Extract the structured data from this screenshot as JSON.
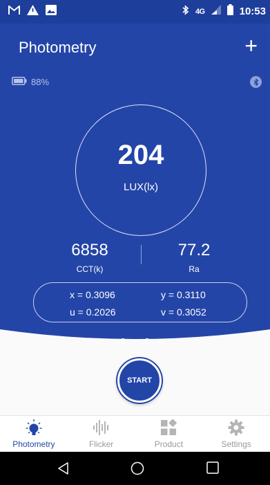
{
  "status_bar": {
    "network": "4G",
    "time": "10:53"
  },
  "app_bar": {
    "title": "Photometry",
    "add_label": "+"
  },
  "device": {
    "battery": "88%"
  },
  "reading": {
    "lux_value": "204",
    "lux_unit": "LUX(lx)",
    "cct_value": "6858",
    "cct_label": "CCT(k)",
    "ra_value": "77.2",
    "ra_label": "Ra",
    "x": "x = 0.3096",
    "y": "y = 0.3110",
    "u": "u = 0.2026",
    "v": "v = 0.3052"
  },
  "pager": {
    "page_count": 2,
    "active_page": 1
  },
  "start_label": "START",
  "tabs": [
    {
      "label": "Photometry",
      "icon": "bulb-icon",
      "active": true
    },
    {
      "label": "Flicker",
      "icon": "waveform-icon",
      "active": false
    },
    {
      "label": "Product",
      "icon": "grid-icon",
      "active": false
    },
    {
      "label": "Settings",
      "icon": "gear-icon",
      "active": false
    }
  ],
  "colors": {
    "primary": "#2445a8",
    "status": "#1e3e9c",
    "inactive": "#9a9a9a"
  }
}
